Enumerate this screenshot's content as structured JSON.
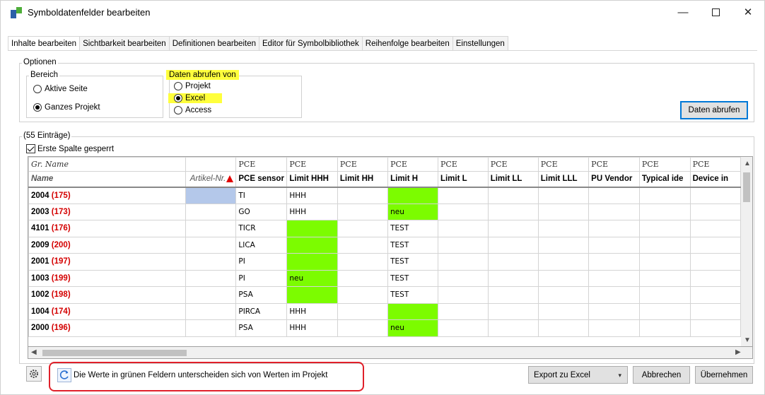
{
  "window": {
    "title": "Symboldatenfelder bearbeiten",
    "minimize": "—",
    "close": "✕"
  },
  "tabs": [
    {
      "label": "Inhalte bearbeiten"
    },
    {
      "label": "Sichtbarkeit bearbeiten"
    },
    {
      "label": "Definitionen bearbeiten"
    },
    {
      "label": "Editor für Symbolbibliothek"
    },
    {
      "label": "Reihenfolge bearbeiten"
    },
    {
      "label": "Einstellungen"
    }
  ],
  "options": {
    "title": "Optionen",
    "bereich": {
      "title": "Bereich",
      "opt1": "Aktive Seite",
      "opt2": "Ganzes Projekt",
      "selected": "Ganzes Projekt"
    },
    "daten": {
      "title": "Daten abrufen von",
      "opt1": "Projekt",
      "opt2": "Excel",
      "opt3": "Access",
      "selected": "Excel"
    },
    "fetch_button": "Daten abrufen"
  },
  "entries": {
    "count_label": "(55 Einträge)",
    "lock_label": "Erste Spalte gesperrt",
    "lock_checked": true
  },
  "grid": {
    "group_header": "Gr. Name",
    "name_header": "Name",
    "artikel_header": "Artikel-Nr.",
    "header_row1": [
      "PCE",
      "PCE",
      "PCE",
      "PCE",
      "PCE",
      "PCE",
      "PCE",
      "PCE",
      "PCE",
      "PCE"
    ],
    "header_row2": [
      "PCE sensor",
      "Limit HHH",
      "Limit HH",
      "Limit H",
      "Limit L",
      "Limit LL",
      "Limit LLL",
      "PU Vendor",
      "Typical ide",
      "Device in"
    ],
    "rows": [
      {
        "id": "2004",
        "cnt": "(175)",
        "sensor": "TI",
        "hhh": "HHH",
        "h": ""
      },
      {
        "id": "2003",
        "cnt": "(173)",
        "sensor": "GO",
        "hhh": "HHH",
        "h": "neu"
      },
      {
        "id": "4101",
        "cnt": "(176)",
        "sensor": "TICR",
        "hhh": "",
        "h": "TEST"
      },
      {
        "id": "2009",
        "cnt": "(200)",
        "sensor": "LICA",
        "hhh": "",
        "h": "TEST"
      },
      {
        "id": "2001",
        "cnt": "(197)",
        "sensor": "PI",
        "hhh": "",
        "h": "TEST"
      },
      {
        "id": "1003",
        "cnt": "(199)",
        "sensor": "PI",
        "hhh": "neu",
        "h": "TEST"
      },
      {
        "id": "1002",
        "cnt": "(198)",
        "sensor": "PSA",
        "hhh": "",
        "h": "TEST"
      },
      {
        "id": "1004",
        "cnt": "(174)",
        "sensor": "PIRCA",
        "hhh": "HHH",
        "h": ""
      },
      {
        "id": "2000",
        "cnt": "(196)",
        "sensor": "PSA",
        "hhh": "HHH",
        "h": "neu"
      }
    ]
  },
  "footer": {
    "info": "Die Werte in grünen Feldern unterscheiden sich von Werten im Projekt",
    "export": "Export zu Excel",
    "cancel": "Abbrechen",
    "apply": "Übernehmen"
  },
  "colors": {
    "changed": "#7cfc00",
    "highlight": "#ffff3c",
    "annotation": "#e0202a",
    "count_red": "#d40000"
  }
}
